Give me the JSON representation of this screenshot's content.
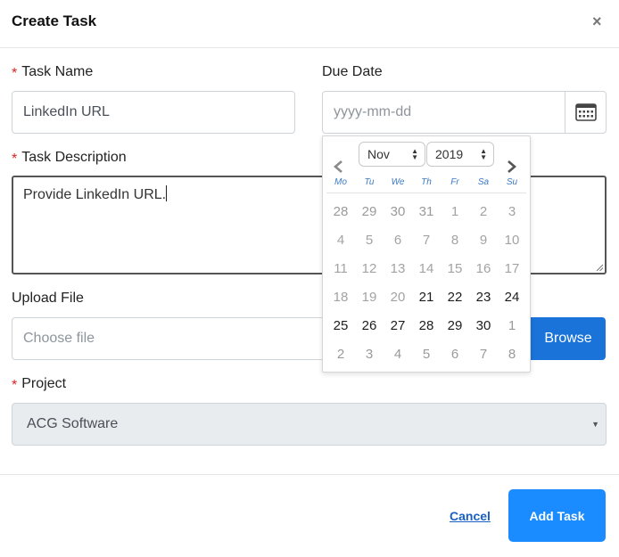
{
  "header": {
    "title": "Create Task",
    "close_glyph": "×"
  },
  "form": {
    "required_mark": "*",
    "task_name": {
      "label": "Task Name",
      "value": "LinkedIn URL"
    },
    "due_date": {
      "label": "Due Date",
      "placeholder": "yyyy-mm-dd"
    },
    "task_description": {
      "label": "Task Description",
      "value": "Provide LinkedIn URL."
    },
    "upload_file": {
      "label": "Upload File",
      "placeholder": "Choose file",
      "browse_label": "Browse"
    },
    "project": {
      "label": "Project",
      "value": "ACG Software"
    }
  },
  "datepicker": {
    "month": "Nov",
    "year": "2019",
    "prev_glyph": "‹",
    "next_glyph": "›",
    "weekdays": [
      "Mo",
      "Tu",
      "We",
      "Th",
      "Fr",
      "Sa",
      "Su"
    ],
    "weeks": [
      [
        "28",
        "29",
        "30",
        "31",
        "1",
        "2",
        "3"
      ],
      [
        "4",
        "5",
        "6",
        "7",
        "8",
        "9",
        "10"
      ],
      [
        "11",
        "12",
        "13",
        "14",
        "15",
        "16",
        "17"
      ],
      [
        "18",
        "19",
        "20",
        "21",
        "22",
        "23",
        "24"
      ],
      [
        "25",
        "26",
        "27",
        "28",
        "29",
        "30",
        "1"
      ],
      [
        "2",
        "3",
        "4",
        "5",
        "6",
        "7",
        "8"
      ]
    ]
  },
  "footer": {
    "cancel_label": "Cancel",
    "submit_label": "Add Task"
  },
  "colors": {
    "accent": "#1a8cff",
    "browse": "#1a73d9",
    "required": "#e02020",
    "weekday": "#3b7ac4"
  }
}
